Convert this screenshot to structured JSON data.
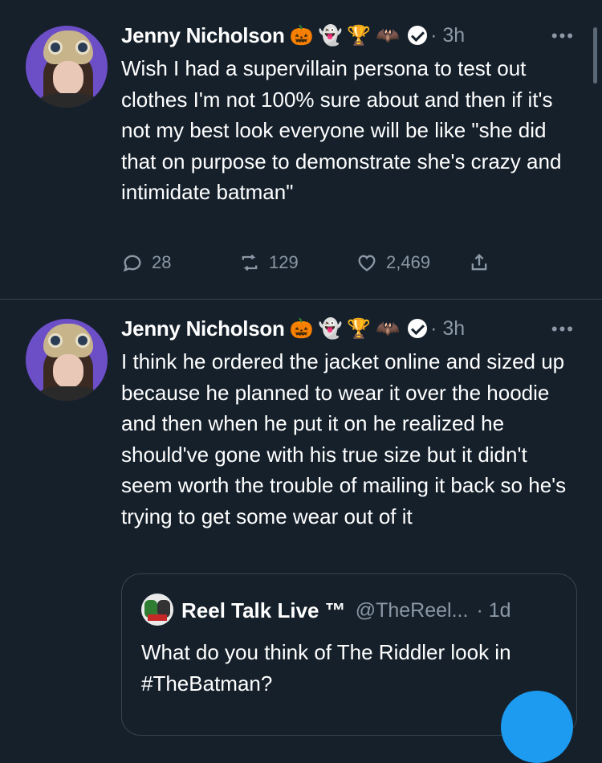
{
  "tweets": [
    {
      "author": "Jenny Nicholson",
      "emojis": [
        "🎃",
        "👻",
        "🏆",
        "🦇"
      ],
      "time": "· 3h",
      "text": "Wish I had a supervillain persona to test out clothes I'm not 100% sure about and then if it's not my best look everyone will be like \"she did that on purpose to demonstrate she's crazy and intimidate batman\"",
      "replies": "28",
      "retweets": "129",
      "likes": "2,469"
    },
    {
      "author": "Jenny Nicholson",
      "emojis": [
        "🎃",
        "👻",
        "🏆",
        "🦇"
      ],
      "time": "· 3h",
      "text": "I think he ordered the jacket online and sized up because he planned to wear it over the hoodie and then when he put it on he realized he should've gone with his true size but it didn't seem worth the trouble of mailing it back so he's trying to get some wear out of it"
    }
  ],
  "quote": {
    "name": "Reel Talk Live ™",
    "handle": "@TheReel...",
    "time": "· 1d",
    "text": "What do you think of The Riddler look in #TheBatman?"
  },
  "more_label": "•••",
  "colors": {
    "background": "#15202b",
    "secondary": "#8b98a5",
    "accent": "#1d9bf0",
    "border": "#38444d"
  },
  "icons": [
    "reply-icon",
    "retweet-icon",
    "like-icon",
    "share-icon",
    "verified-badge-icon",
    "more-icon"
  ]
}
